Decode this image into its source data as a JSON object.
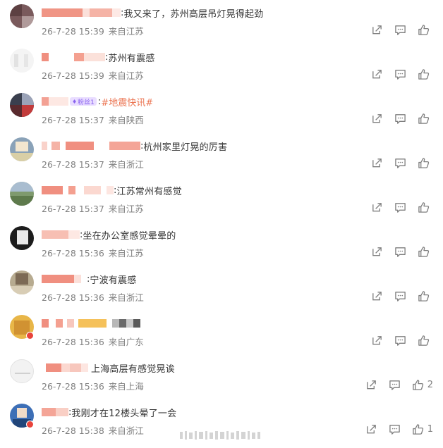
{
  "colors": {
    "username_blur": "#f08f80",
    "username_blur_light": "#f7c7bd",
    "text": "#333333",
    "meta": "#808080",
    "hashtag": "#eb7350",
    "icon": "#7f7f7f"
  },
  "icons": {
    "share": "share-icon",
    "comment": "comment-icon",
    "like": "like-icon"
  },
  "comments": [
    {
      "text": "我又来了，苏州高层吊灯晃得起劲",
      "date": "26-7-28 15:39",
      "source": "来自江苏",
      "like_count": ""
    },
    {
      "text": "苏州有震感",
      "date": "26-7-28 15:39",
      "source": "来自江苏",
      "like_count": ""
    },
    {
      "badge": "粉丝1",
      "hashtag": "#地震快讯#",
      "text": "",
      "date": "26-7-28 15:37",
      "source": "来自陕西",
      "like_count": ""
    },
    {
      "text": "杭州家里灯晃的厉害",
      "date": "26-7-28 15:37",
      "source": "来自浙江",
      "like_count": ""
    },
    {
      "text": "江苏常州有感觉",
      "date": "26-7-28 15:37",
      "source": "来自江苏",
      "like_count": ""
    },
    {
      "text": "坐在办公室感觉晕晕的",
      "date": "26-7-28 15:36",
      "source": "来自江苏",
      "like_count": ""
    },
    {
      "text": "宁波有震感",
      "date": "26-7-28 15:36",
      "source": "来自浙江",
      "like_count": ""
    },
    {
      "text": "",
      "date": "26-7-28 15:36",
      "source": "来自广东",
      "like_count": ""
    },
    {
      "text": "上海高层有感觉晃诶",
      "date": "26-7-28 15:36",
      "source": "来自上海",
      "like_count": "2"
    },
    {
      "text": "我刚才在12楼头晕了一会",
      "date": "26-7-28 15:38",
      "source": "来自浙江",
      "like_count": "1"
    }
  ]
}
